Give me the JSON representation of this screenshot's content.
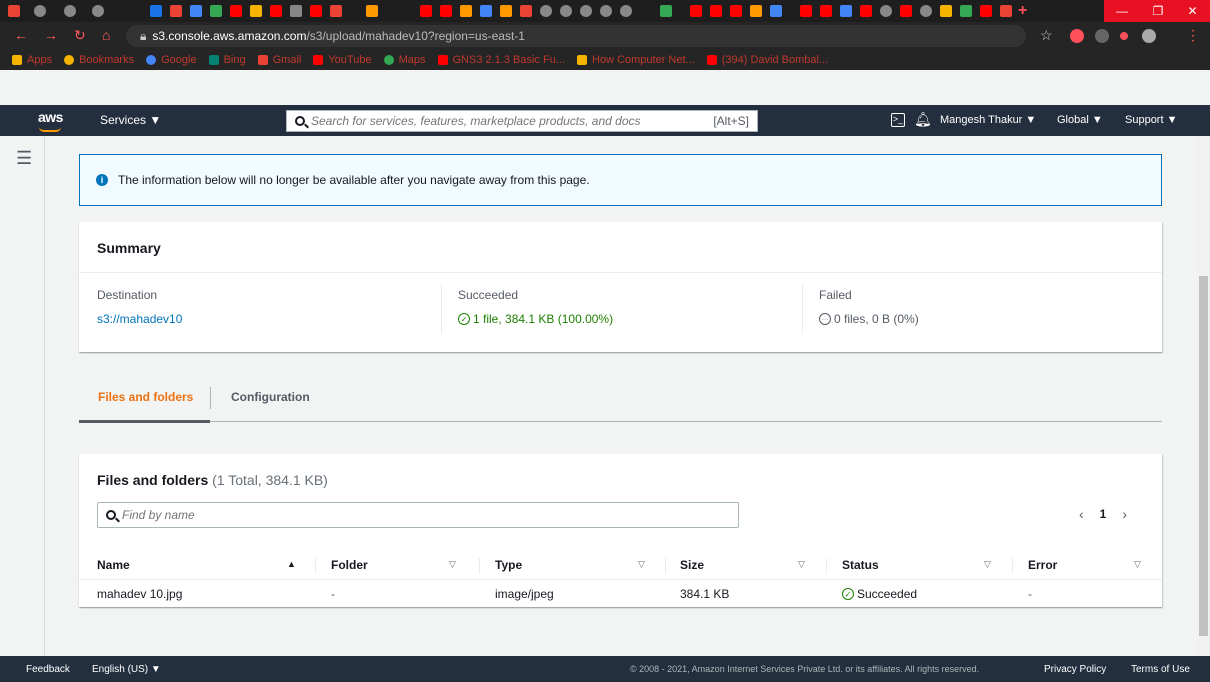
{
  "browser": {
    "url_host": "s3.console.aws.amazon.com",
    "url_path": "/s3/upload/mahadev10?region=us-east-1",
    "bookmarks": [
      {
        "label": "Apps",
        "color": "#f4b400"
      },
      {
        "label": "Bookmarks",
        "color": "#f4b400"
      },
      {
        "label": "Google",
        "color": "#4285f4"
      },
      {
        "label": "Bing",
        "color": "#008373"
      },
      {
        "label": "Gmail",
        "color": "#ea4335"
      },
      {
        "label": "YouTube",
        "color": "#ff0000"
      },
      {
        "label": "Maps",
        "color": "#34a853"
      },
      {
        "label": "GNS3 2.1.3 Basic Fu...",
        "color": "#ff0000"
      },
      {
        "label": "How Computer Net...",
        "color": "#f4b400"
      },
      {
        "label": "(394) David Bombal...",
        "color": "#ff0000"
      }
    ]
  },
  "aws": {
    "logo": "aws",
    "services_label": "Services ▼",
    "search_placeholder": "Search for services, features, marketplace products, and docs",
    "search_shortcut": "[Alt+S]",
    "user_label": "Mangesh Thakur ▼",
    "region_label": "Global ▼",
    "support_label": "Support ▼"
  },
  "banner": {
    "text": "The information below will no longer be available after you navigate away from this page."
  },
  "summary": {
    "title": "Summary",
    "destination_label": "Destination",
    "destination_value": "s3://mahadev10",
    "succeeded_label": "Succeeded",
    "succeeded_value": "1 file, 384.1 KB (100.00%)",
    "failed_label": "Failed",
    "failed_value": "0 files, 0 B (0%)"
  },
  "tabs": {
    "files": "Files and folders",
    "config": "Configuration"
  },
  "files_table": {
    "title": "Files and folders",
    "count": "(1 Total, 384.1 KB)",
    "find_placeholder": "Find by name",
    "page": "1",
    "columns": [
      "Name",
      "Folder",
      "Type",
      "Size",
      "Status",
      "Error"
    ],
    "rows": [
      {
        "name": "mahadev 10.jpg",
        "folder": "-",
        "type": "image/jpeg",
        "size": "384.1 KB",
        "status": "Succeeded",
        "error": "-"
      }
    ]
  },
  "footer": {
    "feedback": "Feedback",
    "language": "English (US) ▼",
    "copyright": "© 2008 - 2021, Amazon Internet Services Private Ltd. or its affiliates. All rights reserved.",
    "privacy": "Privacy Policy",
    "terms": "Terms of Use"
  }
}
